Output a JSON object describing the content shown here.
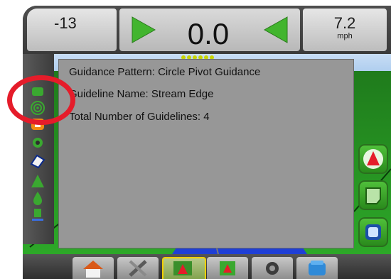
{
  "header": {
    "cross_track_error": "-13",
    "status_readout": "0.0",
    "speed": "7.2",
    "speed_unit": "mph"
  },
  "info": {
    "guidance_pattern": "Guidance Pattern: Circle Pivot Guidance",
    "guideline_name": "Guideline Name: Stream Edge",
    "total_guidelines": "Total Number of Guidelines: 4"
  },
  "left_panel": {
    "icons": [
      "guidance-mode-icon",
      "pivot-circle-icon",
      "pattern-selection-icon",
      "steering-icon",
      "implement-icon",
      "marker-icon",
      "gps-icon",
      "section-icon"
    ]
  },
  "right_panel": {
    "buttons": [
      "go-to-A-button",
      "mark-A-button",
      "mark-B-button"
    ]
  },
  "bottom_tabs": [
    "home-tab",
    "setup-tab",
    "guidance-tab",
    "field-tab",
    "sections-tab",
    "data-tab"
  ],
  "colors": {
    "accent_green": "#4fbf3a",
    "highlight_red": "#e51c2a",
    "active_tab_border": "#f2d000"
  }
}
